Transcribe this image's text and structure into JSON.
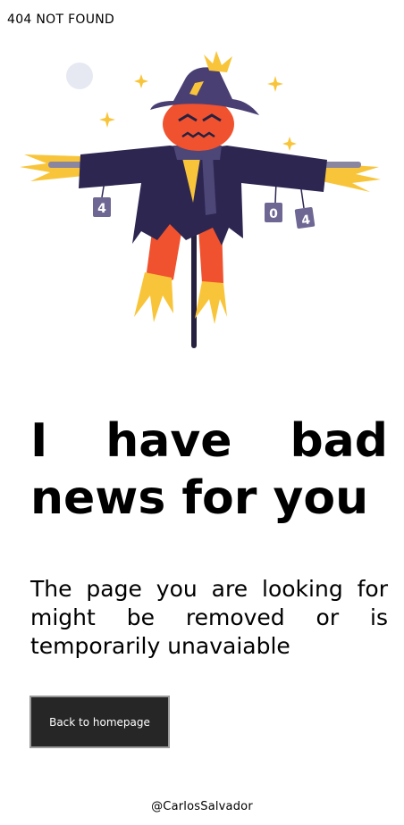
{
  "header": {
    "title": "404 NOT FOUND"
  },
  "illustration": {
    "can_labels": [
      "4",
      "0",
      "4"
    ],
    "colors": {
      "hat": "#4a3f73",
      "coat": "#2d2651",
      "face": "#f0522f",
      "straw": "#f8c53a",
      "scarf": "#4d4778",
      "pole": "#26213f",
      "moon": "#e6e9f2",
      "can": "#6f6793"
    }
  },
  "headline": {
    "line1_words": [
      "I",
      "have",
      "bad"
    ],
    "line2": "news for you"
  },
  "description": {
    "text": "The page you are looking for might be removed or is temporarily unavaiable"
  },
  "cta": {
    "label": "Back to homepage"
  },
  "footer": {
    "credit": "@CarlosSalvador"
  }
}
